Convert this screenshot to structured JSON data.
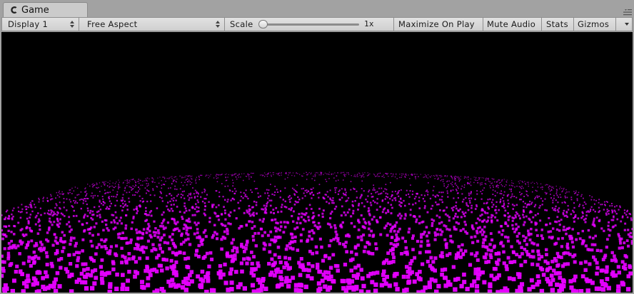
{
  "window": {
    "tab_title": "Game",
    "tab_icon": "game-controller-icon",
    "menu_icon": "panel-menu-icon"
  },
  "toolbar": {
    "display": "Display 1",
    "aspect": "Free Aspect",
    "scale_label": "Scale",
    "scale_value": "1x",
    "scale_slider_fraction": 0.0,
    "maximize_on_play": "Maximize On Play",
    "mute_audio": "Mute Audio",
    "stats": "Stats",
    "gizmos": "Gizmos"
  },
  "viewport": {
    "background_color": "#000000",
    "particle_color": "#e600ff",
    "scene": "particle-field"
  }
}
